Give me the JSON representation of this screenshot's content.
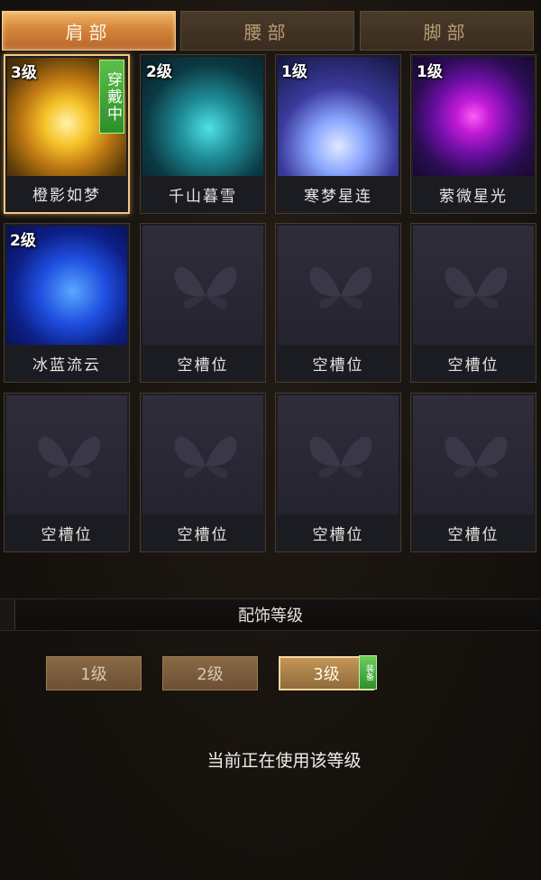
{
  "tabs": [
    {
      "label": "肩部",
      "active": true
    },
    {
      "label": "腰部",
      "active": false
    },
    {
      "label": "脚部",
      "active": false
    }
  ],
  "slots": [
    {
      "name": "橙影如梦",
      "level": "3级",
      "badge": "穿戴中",
      "art": "orange"
    },
    {
      "name": "千山暮雪",
      "level": "2级",
      "art": "teal"
    },
    {
      "name": "寒梦星连",
      "level": "1级",
      "art": "lotus"
    },
    {
      "name": "萦微星光",
      "level": "1级",
      "art": "purple"
    },
    {
      "name": "冰蓝流云",
      "level": "2级",
      "art": "blue"
    },
    {
      "name": "空槽位"
    },
    {
      "name": "空槽位"
    },
    {
      "name": "空槽位"
    },
    {
      "name": "空槽位"
    },
    {
      "name": "空槽位"
    },
    {
      "name": "空槽位"
    },
    {
      "name": "空槽位"
    }
  ],
  "level_panel": {
    "title": "配饰等级",
    "levels": [
      "1级",
      "2级",
      "3级"
    ],
    "selected_index": 2,
    "equip_badge": "装备",
    "status": "当前正在使用该等级"
  },
  "colors": {
    "tab_active": "#d5863a",
    "badge_green": "#3ea83a",
    "selected_border": "#f2c884"
  },
  "icons": {
    "empty_slot": "butterfly-icon"
  }
}
